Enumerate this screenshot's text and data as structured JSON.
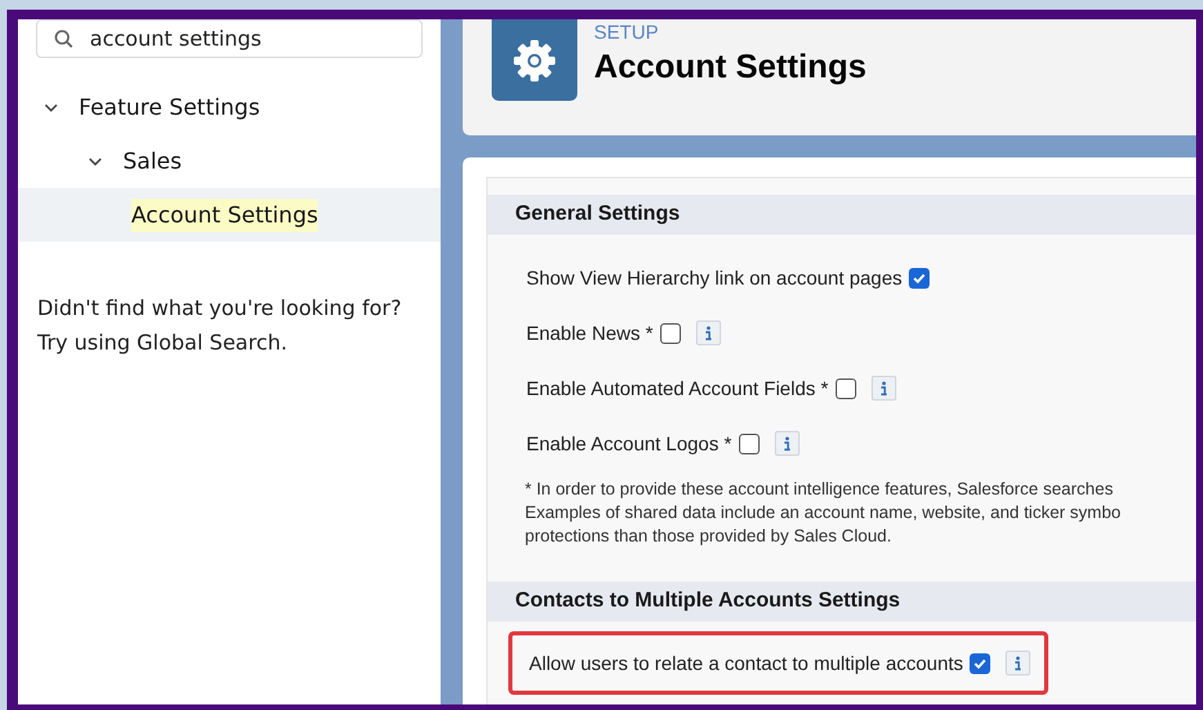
{
  "search": {
    "value": "account settings"
  },
  "tree": [
    {
      "label": "Feature Settings",
      "expanded": true,
      "selected": false,
      "children": [
        {
          "label": "Sales",
          "expanded": true,
          "selected": false,
          "children": [
            {
              "label": "Account Settings",
              "selected": true,
              "highlighted": true
            }
          ]
        }
      ]
    }
  ],
  "help": [
    "Didn't find what you're looking for?",
    "Try using Global Search."
  ],
  "header": {
    "eyebrow": "SETUP",
    "title": "Account Settings"
  },
  "sections": [
    {
      "title": "General Settings",
      "settings": [
        {
          "label": "Show View Hierarchy link on account pages",
          "checked": true,
          "info": false,
          "highlighted": false
        },
        {
          "label": "Enable News *",
          "checked": false,
          "info": true,
          "highlighted": false
        },
        {
          "label": "Enable Automated Account Fields *",
          "checked": false,
          "info": true,
          "highlighted": false
        },
        {
          "label": "Enable Account Logos *",
          "checked": false,
          "info": true,
          "highlighted": false
        }
      ],
      "footnote": [
        "* In order to provide these account intelligence features, Salesforce searches",
        "Examples of shared data include an account name, website, and ticker symbo",
        "protections than those provided by Sales Cloud."
      ]
    },
    {
      "title": "Contacts to Multiple Accounts Settings",
      "settings": [
        {
          "label": "Allow users to relate a contact to multiple accounts",
          "checked": true,
          "info": true,
          "highlighted": true
        }
      ]
    }
  ]
}
